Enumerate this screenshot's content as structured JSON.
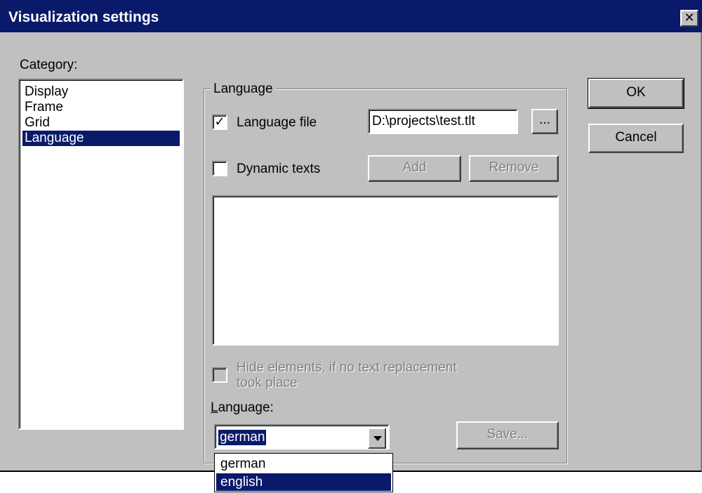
{
  "window": {
    "title": "Visualization settings",
    "close_glyph": "✕"
  },
  "category": {
    "label": "Category:",
    "items": [
      "Display",
      "Frame",
      "Grid",
      "Language"
    ],
    "selected": "Language"
  },
  "buttons": {
    "ok": "OK",
    "cancel": "Cancel"
  },
  "language_group": {
    "title": "Language",
    "language_file": {
      "label": "Language file",
      "checked": true,
      "path": "D:\\projects\\test.tlt",
      "browse_label": "..."
    },
    "dynamic_texts": {
      "label": "Dynamic texts",
      "checked": false,
      "add_label": "Add",
      "remove_label": "Remove"
    },
    "hide_elements": {
      "label_line1": "Hide elements, if no text replacement",
      "label_line2": "took place",
      "checked": false
    },
    "language_label_prefix": "L",
    "language_label_rest": "anguage:",
    "language_combo": {
      "value": "german",
      "options": [
        "german",
        "english"
      ],
      "highlighted": "english"
    },
    "save_label": "Save..."
  },
  "colors": {
    "titlebar": "#0a1a6a",
    "face": "#c0c0c0",
    "selection": "#0a1a6a"
  }
}
